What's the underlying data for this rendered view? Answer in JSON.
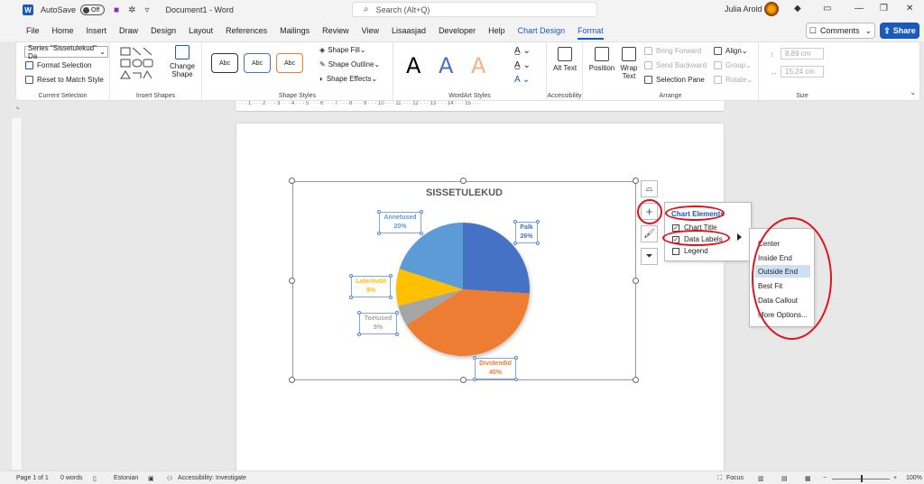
{
  "titlebar": {
    "autosave_label": "AutoSave",
    "autosave_state": "Off",
    "document_name": "Document1 - Word",
    "search_placeholder": "Search (Alt+Q)",
    "user_name": "Julia Arold"
  },
  "menu": {
    "items": [
      "File",
      "Home",
      "Insert",
      "Draw",
      "Design",
      "Layout",
      "References",
      "Mailings",
      "Review",
      "View",
      "Lisaasjad",
      "Developer",
      "Help",
      "Chart Design",
      "Format"
    ],
    "active": "Format",
    "comments_label": "Comments",
    "share_label": "Share"
  },
  "ribbon": {
    "current_selection": {
      "series_select": "Series \"Sissetulekud\" Da",
      "format_selection": "Format Selection",
      "reset_to_match_style": "Reset to Match Style",
      "label": "Current Selection"
    },
    "insert_shapes": {
      "change_shape": "Change Shape",
      "label": "Insert Shapes"
    },
    "shape_styles": {
      "swatch_label": "Abc",
      "shape_fill": "Shape Fill",
      "shape_outline": "Shape Outline",
      "shape_effects": "Shape Effects",
      "label": "Shape Styles"
    },
    "wordart_styles": {
      "letter": "A",
      "label": "WordArt Styles"
    },
    "accessibility": {
      "alt_text": "Alt Text",
      "label": "Accessibility"
    },
    "arrange": {
      "position": "Position",
      "wrap_text": "Wrap Text",
      "bring_forward": "Bring Forward",
      "send_backward": "Send Backward",
      "selection_pane": "Selection Pane",
      "align": "Align",
      "group": "Group",
      "rotate": "Rotate",
      "label": "Arrange"
    },
    "size": {
      "height": "8,89 cm",
      "width": "15,24 cm",
      "label": "Size"
    }
  },
  "ruler_text": "· · · 1 · · · 2 · · · 3 · · · 4 · · · 5 · · · 6 · · · 7 · · · 8 · · · 9 · · · 10 · · · 11 · · · 12 · · · 13 · · · 14 · · · 15 · · ·",
  "chart_data": {
    "type": "pie",
    "title": "SISSETULEKUD",
    "categories": [
      "Palk",
      "Dividendid",
      "Toetused",
      "Loteriivõit",
      "Annetused"
    ],
    "values": [
      26,
      40,
      5,
      9,
      20
    ],
    "value_labels": [
      "26%",
      "40%",
      "5%",
      "9%",
      "20%"
    ],
    "colors": [
      "#4472c4",
      "#ed7d31",
      "#a5a5a5",
      "#ffc000",
      "#5b9bd5"
    ],
    "legend": false
  },
  "chart_elements": {
    "title": "Chart Elements",
    "items": [
      {
        "label": "Chart Title",
        "checked": true
      },
      {
        "label": "Data Labels",
        "checked": true
      },
      {
        "label": "Legend",
        "checked": false
      }
    ]
  },
  "data_labels_menu": {
    "items": [
      "Center",
      "Inside End",
      "Outside End",
      "Best Fit",
      "Data Callout",
      "More Options..."
    ],
    "highlighted": "Outside End"
  },
  "statusbar": {
    "page": "Page 1 of 1",
    "words": "0 words",
    "language": "Estonian",
    "accessibility": "Accessibility: Investigate",
    "focus": "Focus",
    "zoom": "100%"
  }
}
